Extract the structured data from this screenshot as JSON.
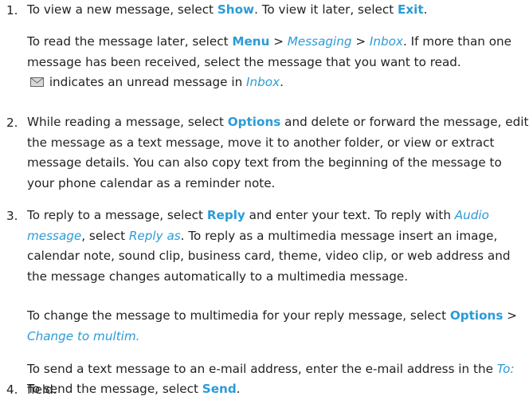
{
  "items": [
    {
      "num": "1.",
      "p1": {
        "t1": "To view a new message, select ",
        "k1": "Show",
        "t2": ". To view it later, select ",
        "k2": "Exit",
        "t3": "."
      },
      "p2": {
        "t1": "To read the message later, select ",
        "k1": "Menu",
        "sep1": " > ",
        "k2": "Messaging",
        "sep2": " > ",
        "k3": "Inbox",
        "t2": ". If more than one message has been received, select the message that you want to read.",
        "icon": "unread-envelope-icon",
        "t3": " indicates an unread message in ",
        "k4": "Inbox",
        "t4": "."
      }
    },
    {
      "num": "2.",
      "p1": {
        "t1": "While reading a message, select ",
        "k1": "Options",
        "t2": " and delete or forward the message, edit the message as a text message, move it to another folder, or view or extract message details. You can also copy text from the beginning of the message to your phone calendar as a reminder note."
      }
    },
    {
      "num": "3.",
      "p1": {
        "t1": "To reply to a message, select ",
        "k1": "Reply",
        "t2": " and enter your text. To reply with ",
        "k2": "Audio message",
        "t3": ", select ",
        "k3": "Reply as",
        "t4": ". To reply as a multimedia message insert an image, calendar note, sound clip, business card, theme, video clip, or web address and the message changes automatically to a multimedia message."
      },
      "p2": {
        "t1": "To change the message to multimedia for your reply message, select ",
        "k1": "Options",
        "sep1": " > ",
        "k2": "Change to multim."
      },
      "p3": {
        "t1": "To send a text message to an e-mail address, enter the e-mail address in the ",
        "k1": "To:",
        "t2": " field."
      }
    },
    {
      "num": "4.",
      "p1": {
        "t1": "To send the message, select ",
        "k1": "Send",
        "t2": "."
      }
    }
  ]
}
